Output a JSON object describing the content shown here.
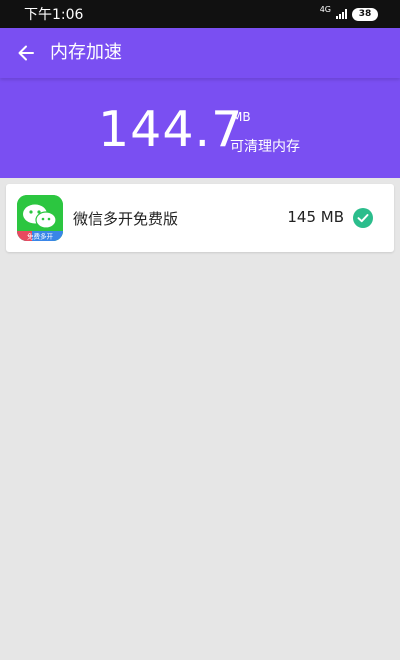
{
  "status_bar": {
    "time": "下午1:06",
    "network": "4G",
    "battery": "38"
  },
  "header": {
    "title": "内存加速",
    "amount": "144.7",
    "unit": "MB",
    "hint": "可清理内存"
  },
  "apps": [
    {
      "name": "微信多开免费版",
      "icon_caption": "免费多开",
      "size": "145 MB",
      "selected": true
    }
  ],
  "colors": {
    "accent": "#7a4ff2",
    "check": "#2bbd8c",
    "background": "#e6e6e6"
  }
}
